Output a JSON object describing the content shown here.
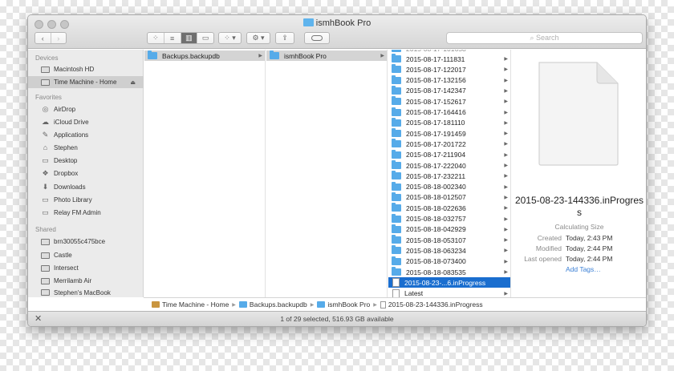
{
  "window": {
    "title": "ismhBook Pro"
  },
  "toolbar": {
    "back_icon": "chevron-left-icon",
    "forward_icon": "chevron-right-icon",
    "search_placeholder": "Search",
    "view_modes": [
      "icon-view-icon",
      "list-view-icon",
      "column-view-icon",
      "cover-flow-icon"
    ],
    "active_view": "column-view-icon"
  },
  "sidebar": {
    "devices_heading": "Devices",
    "devices": [
      {
        "label": "Macintosh HD",
        "icon": "hard-disk-icon"
      },
      {
        "label": "Time Machine - Home",
        "icon": "hard-disk-icon",
        "selected": true
      }
    ],
    "favorites_heading": "Favorites",
    "favorites": [
      {
        "label": "AirDrop",
        "icon": "airdrop-icon",
        "glyph": "◎"
      },
      {
        "label": "iCloud Drive",
        "icon": "cloud-icon",
        "glyph": "☁"
      },
      {
        "label": "Applications",
        "icon": "applications-icon",
        "glyph": "✎"
      },
      {
        "label": "Stephen",
        "icon": "home-icon",
        "glyph": "⌂"
      },
      {
        "label": "Desktop",
        "icon": "desktop-icon",
        "glyph": "▭"
      },
      {
        "label": "Dropbox",
        "icon": "dropbox-icon",
        "glyph": "❖"
      },
      {
        "label": "Downloads",
        "icon": "downloads-icon",
        "glyph": "⬇"
      },
      {
        "label": "Photo Library",
        "icon": "folder-icon",
        "glyph": "▭"
      },
      {
        "label": "Relay FM Admin",
        "icon": "folder-icon",
        "glyph": "▭"
      }
    ],
    "shared_heading": "Shared",
    "shared": [
      {
        "label": "brn30055c475bce",
        "icon": "computer-icon"
      },
      {
        "label": "Castle",
        "icon": "computer-icon"
      },
      {
        "label": "Intersect",
        "icon": "computer-icon"
      },
      {
        "label": "Merrilamb Air",
        "icon": "laptop-icon"
      },
      {
        "label": "Stephen's MacBook",
        "icon": "laptop-icon"
      }
    ]
  },
  "columns": {
    "col1": [
      {
        "label": "Backups.backupdb",
        "selected": true
      }
    ],
    "col2": [
      {
        "label": "ismhBook Pro",
        "selected": true
      }
    ],
    "col3": [
      "2015-08-17-111831",
      "2015-08-17-122017",
      "2015-08-17-132156",
      "2015-08-17-142347",
      "2015-08-17-152617",
      "2015-08-17-164416",
      "2015-08-17-181110",
      "2015-08-17-191459",
      "2015-08-17-201722",
      "2015-08-17-211904",
      "2015-08-17-222040",
      "2015-08-17-232211",
      "2015-08-18-002340",
      "2015-08-18-012507",
      "2015-08-18-022636",
      "2015-08-18-032757",
      "2015-08-18-042929",
      "2015-08-18-053107",
      "2015-08-18-063234",
      "2015-08-18-073400",
      "2015-08-18-083535"
    ],
    "col3_selected": "2015-08-23-...6.inProgress",
    "col3_last": "Latest"
  },
  "preview": {
    "name": "2015-08-23-144336.inProgress",
    "size_label": "Calculating Size",
    "created_key": "Created",
    "created_value": "Today, 2:43 PM",
    "modified_key": "Modified",
    "modified_value": "Today, 2:44 PM",
    "last_opened_key": "Last opened",
    "last_opened_value": "Today, 2:44 PM",
    "add_tags": "Add Tags…"
  },
  "pathbar": [
    "Time Machine - Home",
    "Backups.backupdb",
    "ismhBook Pro",
    "2015-08-23-144336.inProgress"
  ],
  "status": {
    "text": "1 of 29 selected, 516.93 GB available"
  },
  "colors": {
    "selection_blue": "#1a6ecf",
    "folder_blue": "#56abe9",
    "link": "#3a7fd5"
  }
}
